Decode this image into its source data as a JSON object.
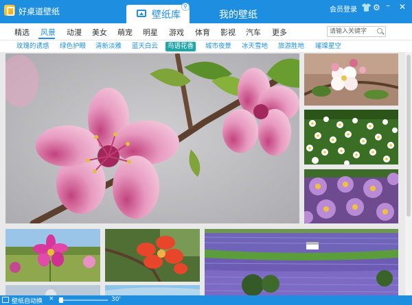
{
  "app": {
    "title": "好桌道壁纸"
  },
  "header": {
    "tabs": [
      {
        "label": "壁纸库",
        "active": true
      },
      {
        "label": "我的壁纸",
        "active": false
      }
    ],
    "login_label": "会员登录",
    "icons": [
      "shirt-icon",
      "gear-icon",
      "minimize-icon",
      "close-icon"
    ]
  },
  "categories": [
    "精选",
    "风景",
    "动漫",
    "美女",
    "萌宠",
    "明星",
    "游戏",
    "体育",
    "影视",
    "汽车",
    "更多"
  ],
  "active_category": "风景",
  "search": {
    "placeholder": "请输入关键字"
  },
  "subtags": [
    "玫瑰的诱惑",
    "绿色护眼",
    "清新淡雅",
    "蓝天白云",
    "鸟语花香",
    "城市夜景",
    "冰天雪地",
    "旅游胜地",
    "璀璨星空"
  ],
  "active_subtag": "鸟语花香",
  "footer": {
    "auto_switch_label": "壁纸自动换",
    "close_symbol": "×",
    "interval_value": "30'"
  },
  "colors": {
    "brand": "#1e8fe0",
    "active_subtag_bg": "#1fa6a6"
  },
  "tiles": [
    "peach-blossom-large",
    "white-apple-blossom",
    "white-daisy-field",
    "purple-osteospermum",
    "pink-cosmos-flower",
    "red-cotton-flower",
    "lavender-field",
    "daisy-partial",
    "sky-partial"
  ]
}
